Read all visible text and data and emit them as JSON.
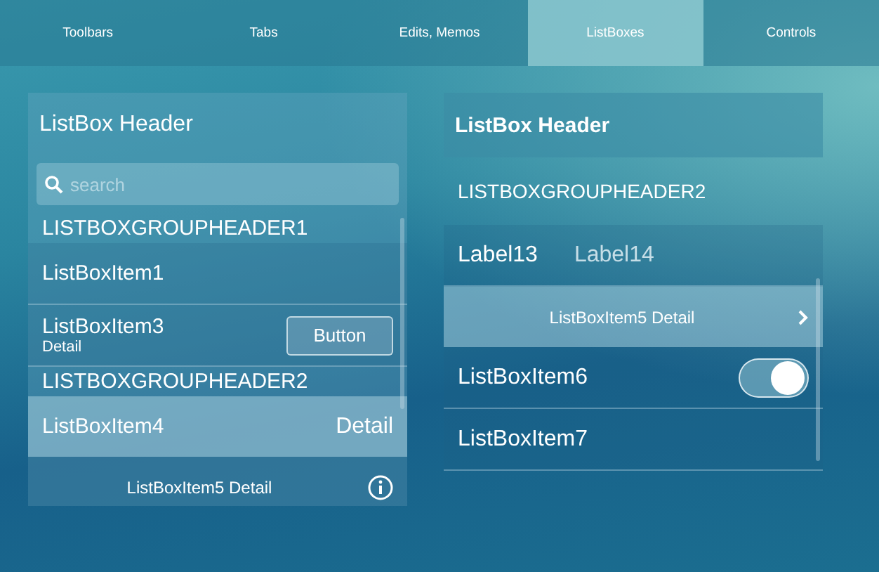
{
  "tabs": [
    {
      "label": "Toolbars",
      "selected": false
    },
    {
      "label": "Tabs",
      "selected": false
    },
    {
      "label": "Edits, Memos",
      "selected": false
    },
    {
      "label": "ListBoxes",
      "selected": true
    },
    {
      "label": "Controls",
      "selected": false
    }
  ],
  "left_listbox": {
    "header": "ListBox Header",
    "search": {
      "placeholder": "search"
    },
    "items": [
      {
        "kind": "group_header",
        "text": "LISTBOXGROUPHEADER1"
      },
      {
        "kind": "item",
        "text": "ListBoxItem1",
        "selected": false
      },
      {
        "kind": "button",
        "text": "ListBoxItem3",
        "detail": "Detail",
        "button": "Button",
        "selected": false
      },
      {
        "kind": "group_header",
        "text": "LISTBOXGROUPHEADER2"
      },
      {
        "kind": "detail_right",
        "text": "ListBoxItem4",
        "detail": "Detail",
        "selected": true
      },
      {
        "kind": "info",
        "text": "ListBoxItem5",
        "detail": "Detail",
        "selected": false
      }
    ]
  },
  "right_listbox": {
    "header": "ListBox Header",
    "items": [
      {
        "kind": "group_header",
        "text": "LISTBOXGROUPHEADER2"
      },
      {
        "kind": "labels",
        "text": "Label13",
        "label2": "Label14",
        "selected": false
      },
      {
        "kind": "chevron",
        "text": "ListBoxItem5",
        "detail": "Detail",
        "selected": true
      },
      {
        "kind": "switch",
        "text": "ListBoxItem6",
        "on": true,
        "selected": false
      },
      {
        "kind": "item",
        "text": "ListBoxItem7",
        "selected": false
      }
    ]
  }
}
